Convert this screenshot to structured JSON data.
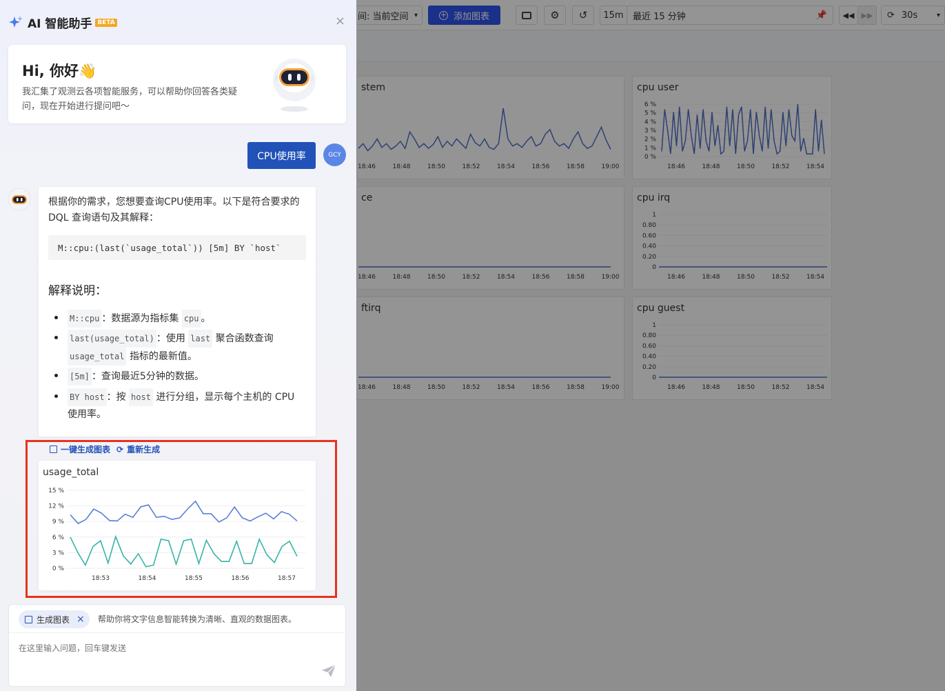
{
  "topbar": {
    "space_label": "间: 当前空间",
    "add_chart": "添加图表",
    "range_short": "15m",
    "range_text": "最近 15 分钟",
    "refresh": "30s"
  },
  "right_panels": [
    {
      "title": "stem",
      "ticks_y": [],
      "x_ticks": [
        "18:46",
        "18:48",
        "18:50",
        "18:52",
        "18:54",
        "18:56",
        "18:58",
        "19:00"
      ]
    },
    {
      "title": "cpu user",
      "ticks_y": [
        "6 %",
        "5 %",
        "4 %",
        "3 %",
        "2 %",
        "1 %",
        "0 %"
      ],
      "x_ticks": [
        "18:46",
        "18:48",
        "18:50",
        "18:52",
        "18:54",
        "18:56",
        "18:58",
        "19:00"
      ]
    },
    {
      "title": "ce",
      "ticks_y": [],
      "x_ticks": [
        "18:46",
        "18:48",
        "18:50",
        "18:52",
        "18:54",
        "18:56",
        "18:58",
        "19:00"
      ]
    },
    {
      "title": "cpu irq",
      "ticks_y": [
        "1",
        "0.80",
        "0.60",
        "0.40",
        "0.20",
        "0"
      ],
      "x_ticks": [
        "18:46",
        "18:48",
        "18:50",
        "18:52",
        "18:54",
        "18:56",
        "18:58",
        "19:00"
      ]
    },
    {
      "title": "ftirq",
      "ticks_y": [],
      "x_ticks": [
        "18:46",
        "18:48",
        "18:50",
        "18:52",
        "18:54",
        "18:56",
        "18:58",
        "19:00"
      ]
    },
    {
      "title": "cpu guest",
      "ticks_y": [
        "1",
        "0.80",
        "0.60",
        "0.40",
        "0.20",
        "0"
      ],
      "x_ticks": [
        "18:46",
        "18:48",
        "18:50",
        "18:52",
        "18:54",
        "18:56",
        "18:58",
        "19:00"
      ]
    }
  ],
  "assistant": {
    "title": "AI 智能助手",
    "badge": "BETA",
    "greeting": "Hi, 你好👋",
    "intro": "我汇集了观测云各项智能服务，可以帮助你回答各类疑问，现在开始进行提问吧～",
    "user_message": "CPU使用率",
    "user_avatar": "GCY",
    "reply_intro": "根据你的需求，您想要查询CPU使用率。以下是符合要求的 DQL 查询语句及其解释：",
    "query": "M::cpu:(last(`usage_total`)) [5m] BY `host`",
    "explain_title": "解释说明：",
    "b1_code": "M::cpu",
    "b1_text": "：数据源为指标集",
    "b1_code2": "cpu",
    "b1_end": "。",
    "b2_code": "last(usage_total)",
    "b2_text": "：使用",
    "b2_code2": "last",
    "b2_text2": "聚合函数查询",
    "b2_code3": "usage_total",
    "b2_end": "指标的最新值。",
    "b3_code": "[5m]",
    "b3_text": "：查询最近5分钟的数据。",
    "b4_code": "BY host",
    "b4_text": "：按",
    "b4_code2": "host",
    "b4_text2": "进行分组，显示每个主机的 CPU",
    "b4_text3": "使用率。",
    "gen_chart": "一键生成图表",
    "regen": "重新生成",
    "tag": "生成图表",
    "tag_desc": "帮助你将文字信息智能转换为清晰、直观的数据图表。",
    "placeholder": "在这里输入问题，回车键发送"
  },
  "chart_data": {
    "type": "line",
    "title": "usage_total",
    "ylim": [
      0,
      15
    ],
    "y_ticks": [
      "0 %",
      "3 %",
      "6 %",
      "9 %",
      "12 %",
      "15 %"
    ],
    "x": [
      "18:52:40",
      "18:52:48",
      "18:52:56",
      "18:53:04",
      "18:53:12",
      "18:53:20",
      "18:53:28",
      "18:53:36",
      "18:53:44",
      "18:53:52",
      "18:54:00",
      "18:54:08",
      "18:54:16",
      "18:54:24",
      "18:54:32",
      "18:54:40",
      "18:54:48",
      "18:54:56",
      "18:55:04",
      "18:55:12",
      "18:55:20",
      "18:55:28",
      "18:55:36",
      "18:55:44",
      "18:55:52",
      "18:56:00",
      "18:56:08",
      "18:56:16",
      "18:56:24",
      "18:56:32",
      "18:56:40",
      "18:56:48",
      "18:56:56",
      "18:57:04",
      "18:57:12"
    ],
    "x_ticks": [
      "18:53",
      "18:54",
      "18:55",
      "18:56",
      "18:57"
    ],
    "series": [
      {
        "color": "#5b7fd6",
        "values": [
          10.3,
          8.6,
          9.4,
          11.4,
          10.6,
          9.2,
          9.1,
          10.4,
          9.8,
          11.8,
          12.2,
          9.8,
          10.0,
          9.4,
          9.7,
          11.4,
          12.9,
          10.5,
          10.5,
          8.9,
          9.7,
          11.8,
          9.7,
          9.1,
          9.9,
          10.6,
          9.5,
          10.9,
          10.4,
          9.1
        ]
      },
      {
        "color": "#36b3a8",
        "values": [
          6.0,
          3.0,
          0.6,
          4.2,
          5.3,
          1.0,
          6.1,
          2.4,
          0.8,
          2.8,
          0.3,
          0.6,
          5.6,
          5.3,
          0.8,
          5.3,
          5.6,
          0.9,
          5.4,
          2.8,
          1.3,
          1.3,
          5.2,
          0.9,
          0.9,
          5.6,
          2.6,
          1.1,
          4.2,
          5.2,
          2.3
        ]
      }
    ]
  }
}
